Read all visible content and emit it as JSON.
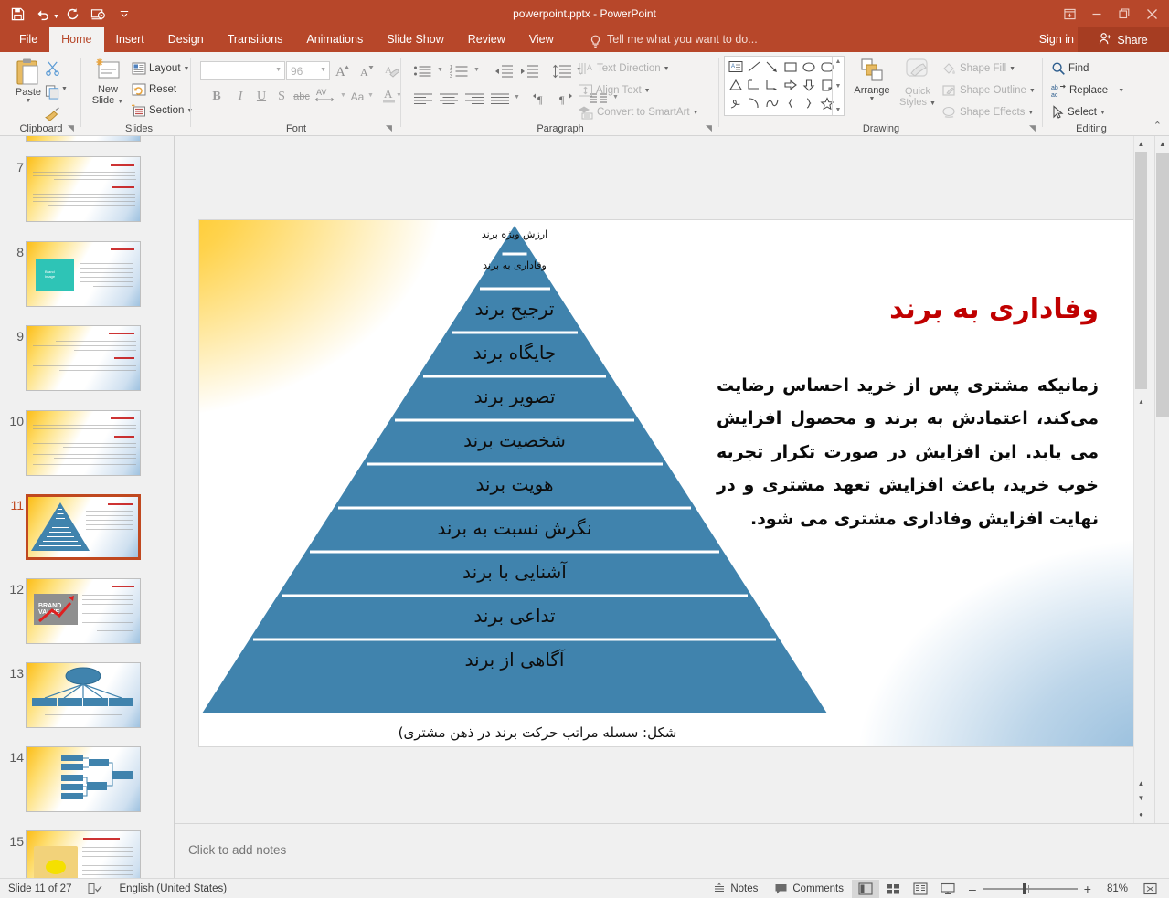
{
  "window": {
    "title": "powerpoint.pptx - PowerPoint",
    "quick_access": [
      {
        "name": "save-icon",
        "label": "Save"
      },
      {
        "name": "undo-icon",
        "label": "Undo"
      },
      {
        "name": "redo-icon",
        "label": "Repeat"
      },
      {
        "name": "start-slideshow-icon",
        "label": "Start From Beginning"
      },
      {
        "name": "customize-qat-icon",
        "label": "Customize Quick Access Toolbar"
      }
    ],
    "controls": {
      "ribbon_display": "⤓",
      "minimize": "–",
      "restore": "❐",
      "close": "✕"
    }
  },
  "tabs": [
    {
      "label": "File",
      "active": false
    },
    {
      "label": "Home",
      "active": true
    },
    {
      "label": "Insert",
      "active": false
    },
    {
      "label": "Design",
      "active": false
    },
    {
      "label": "Transitions",
      "active": false
    },
    {
      "label": "Animations",
      "active": false
    },
    {
      "label": "Slide Show",
      "active": false
    },
    {
      "label": "Review",
      "active": false
    },
    {
      "label": "View",
      "active": false
    }
  ],
  "tell_me": "Tell me what you want to do...",
  "sign_in": "Sign in",
  "share": "Share",
  "ribbon": {
    "groups": [
      {
        "label": "Clipboard"
      },
      {
        "label": "Slides"
      },
      {
        "label": "Font"
      },
      {
        "label": "Paragraph"
      },
      {
        "label": "Drawing"
      },
      {
        "label": "Editing"
      }
    ],
    "clipboard": {
      "paste": "Paste",
      "cut": "Cut",
      "copy": "Copy",
      "format_painter": "Format Painter"
    },
    "slides": {
      "new_slide": "New\nSlide",
      "new_slide_line1": "New",
      "new_slide_line2": "Slide",
      "layout": "Layout",
      "reset": "Reset",
      "section": "Section"
    },
    "font": {
      "font_name": "",
      "font_name_placeholder": "",
      "font_size": "96",
      "grow_font": "A",
      "shrink_font": "A",
      "clear_formatting": "Clear All Formatting",
      "bold": "B",
      "italic": "I",
      "underline": "U",
      "shadow": "S",
      "strikethrough": "abc",
      "character_spacing": "AV",
      "change_case": "Aa",
      "font_color": "A"
    },
    "paragraph": {
      "text_direction": "Text Direction",
      "align_text": "Align Text",
      "convert_to_smartart": "Convert to SmartArt"
    },
    "drawing": {
      "arrange": "Arrange",
      "quick_styles_line1": "Quick",
      "quick_styles_line2": "Styles",
      "shape_fill": "Shape Fill",
      "shape_outline": "Shape Outline",
      "shape_effects": "Shape Effects"
    },
    "editing": {
      "find": "Find",
      "replace": "Replace",
      "select": "Select"
    }
  },
  "slide_panel": {
    "thumbnails": [
      {
        "number": "7",
        "selected": false,
        "kind": "text"
      },
      {
        "number": "8",
        "selected": false,
        "kind": "image-left"
      },
      {
        "number": "9",
        "selected": false,
        "kind": "text"
      },
      {
        "number": "10",
        "selected": false,
        "kind": "text"
      },
      {
        "number": "11",
        "selected": true,
        "kind": "pyramid"
      },
      {
        "number": "12",
        "selected": false,
        "kind": "image-left"
      },
      {
        "number": "13",
        "selected": false,
        "kind": "orgchart"
      },
      {
        "number": "14",
        "selected": false,
        "kind": "tree"
      },
      {
        "number": "15",
        "selected": false,
        "kind": "image-left"
      }
    ]
  },
  "slide": {
    "title": "وفاداری به برند",
    "body": "زمانیکه مشتری پس از خرید احساس رضایت می‌کند، اعتمادش به برند و محصول افزایش می یابد. این افزایش در صورت تکرار تجربه خوب خرید، باعث افزایش تعهد مشتری و در نهایت افزایش وفاداری مشتری می شود.",
    "caption": "شکل: سسله مراتب حرکت برند در ذهن مشتری)"
  },
  "chart_data": {
    "type": "pyramid",
    "title": "سلسله مراتب حرکت برند در ذهن مشتری",
    "levels_top_to_bottom": [
      {
        "rank": 1,
        "label": "ارزش ویژه برند"
      },
      {
        "rank": 2,
        "label": "وفاداری به برند"
      },
      {
        "rank": 3,
        "label": "ترجیح برند"
      },
      {
        "rank": 4,
        "label": "جایگاه برند"
      },
      {
        "rank": 5,
        "label": "تصویر برند"
      },
      {
        "rank": 6,
        "label": "شخصیت برند"
      },
      {
        "rank": 7,
        "label": "هویت برند"
      },
      {
        "rank": 8,
        "label": "نگرش نسبت به برند"
      },
      {
        "rank": 9,
        "label": "آشنایی با برند"
      },
      {
        "rank": 10,
        "label": "تداعی برند"
      },
      {
        "rank": 11,
        "label": "آگاهی از برند"
      }
    ],
    "band_color": "#4083ad",
    "separator_color": "#ffffff"
  },
  "notes": {
    "placeholder": "Click to add notes"
  },
  "status": {
    "slide_counter": "Slide 11 of 27",
    "language": "English (United States)",
    "notes_button": "Notes",
    "comments_button": "Comments",
    "zoom_level": "81%",
    "zoom_out": "–",
    "zoom_in": "+"
  },
  "colors": {
    "brand_accent": "#b7472a",
    "share_bg": "#a63d22",
    "pyramid_band": "#4083ad",
    "slide_title_red": "#c00000",
    "selection_border": "#c0481f"
  }
}
